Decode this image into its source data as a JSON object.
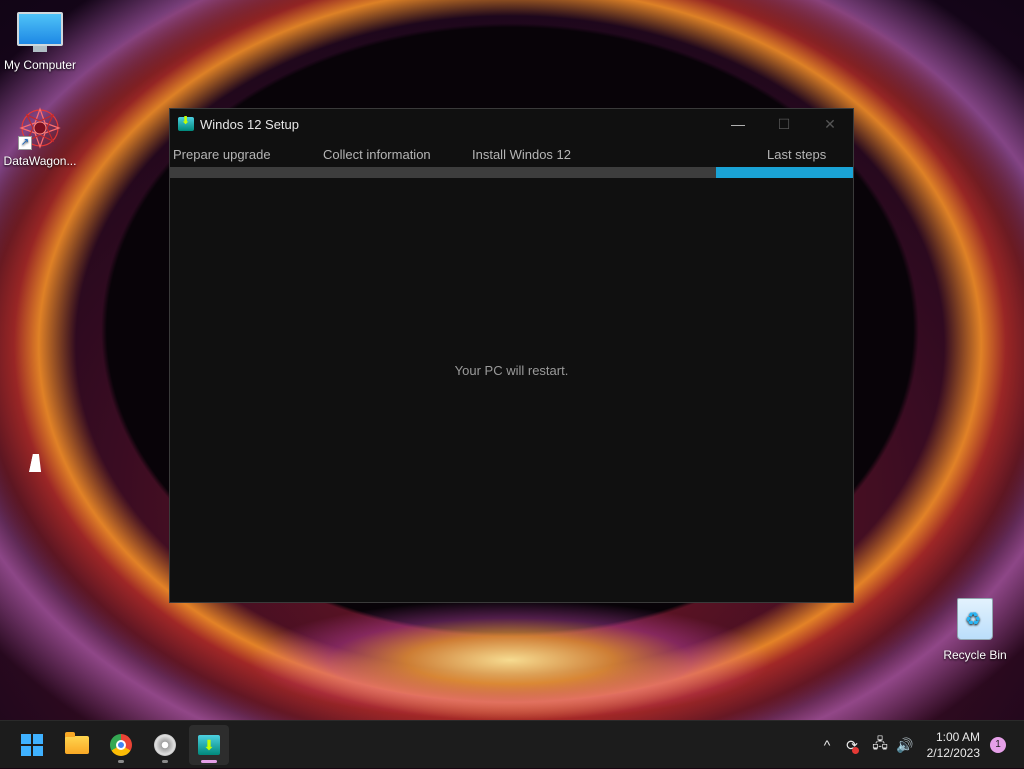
{
  "desktop": {
    "icons": [
      {
        "label": "My Computer",
        "icon": "monitor-icon"
      },
      {
        "label": "DataWagon...",
        "icon": "datawagon-logo-icon"
      },
      {
        "label": "Recycle Bin",
        "icon": "recycle-bin-icon"
      }
    ]
  },
  "window": {
    "title": "Windos 12 Setup",
    "controls": {
      "minimize": "—",
      "maximize": "☐",
      "close": "✕"
    },
    "steps": [
      "Prepare upgrade",
      "Collect information",
      "Install Windos 12",
      "Last steps"
    ],
    "progress_fraction": 0.2,
    "message": "Your PC will restart.",
    "accent_color": "#1aa3d6"
  },
  "taskbar": {
    "apps": [
      {
        "name": "start",
        "icon": "windows-logo-icon"
      },
      {
        "name": "file-explorer",
        "icon": "folder-icon"
      },
      {
        "name": "chrome",
        "icon": "chrome-icon"
      },
      {
        "name": "disc-app",
        "icon": "disc-icon"
      },
      {
        "name": "windos-setup",
        "icon": "setup-icon"
      }
    ],
    "tray": {
      "chevron": "^",
      "sync": "⟳",
      "network": "🖧",
      "volume": "🔊"
    },
    "clock": {
      "time": "1:00 AM",
      "date": "2/12/2023"
    },
    "notification_count": "1"
  }
}
